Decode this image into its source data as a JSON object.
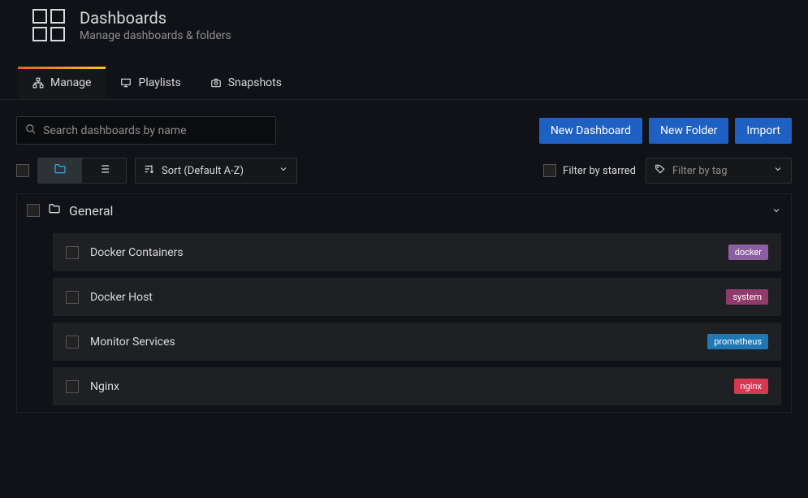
{
  "header": {
    "title": "Dashboards",
    "subtitle": "Manage dashboards & folders"
  },
  "tabs": [
    {
      "label": "Manage",
      "active": true
    },
    {
      "label": "Playlists",
      "active": false
    },
    {
      "label": "Snapshots",
      "active": false
    }
  ],
  "search": {
    "placeholder": "Search dashboards by name"
  },
  "buttons": {
    "new_dashboard": "New Dashboard",
    "new_folder": "New Folder",
    "import": "Import"
  },
  "sort": {
    "label": "Sort (Default A-Z)"
  },
  "filter_starred": {
    "label": "Filter by starred"
  },
  "filter_tag": {
    "label": "Filter by tag"
  },
  "folder": {
    "name": "General"
  },
  "items": [
    {
      "name": "Docker Containers",
      "tag": "docker",
      "tag_color": "tag-purple"
    },
    {
      "name": "Docker Host",
      "tag": "system",
      "tag_color": "tag-magenta"
    },
    {
      "name": "Monitor Services",
      "tag": "prometheus",
      "tag_color": "tag-blue"
    },
    {
      "name": "Nginx",
      "tag": "nginx",
      "tag_color": "tag-red"
    }
  ]
}
